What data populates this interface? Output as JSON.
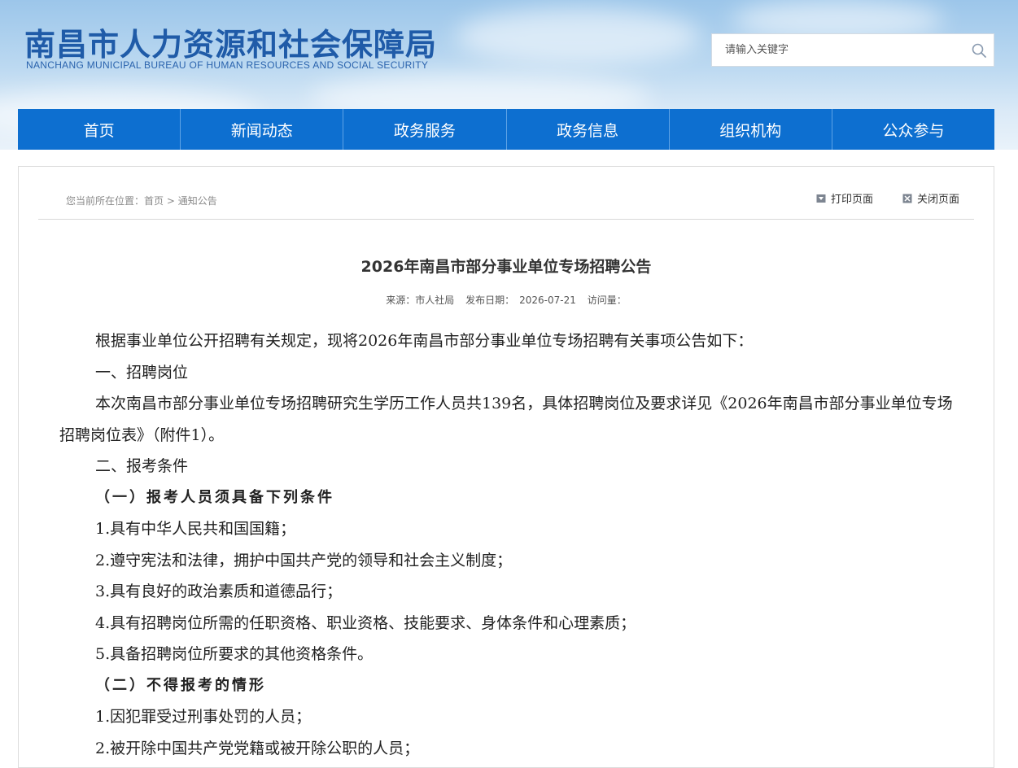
{
  "header": {
    "title": "南昌市人力资源和社会保障局",
    "subtitle": "NANCHANG MUNICIPAL BUREAU OF HUMAN RESOURCES AND SOCIAL SECURITY",
    "search_placeholder": "请输入关键字"
  },
  "nav": {
    "items": [
      "首页",
      "新闻动态",
      "政务服务",
      "政务信息",
      "组织机构",
      "公众参与"
    ]
  },
  "breadcrumb": {
    "prefix": "您当前所在位置：",
    "home": "首页",
    "sep": " > ",
    "current": "通知公告"
  },
  "tools": {
    "print": "打印页面",
    "close": "关闭页面"
  },
  "article": {
    "title": "2026年南昌市部分事业单位专场招聘公告",
    "source_label": "来源：",
    "source": "市人社局",
    "date_label": "发布日期：",
    "date": "2026-07-21",
    "views_label": "访问量：",
    "paragraphs": [
      "根据事业单位公开招聘有关规定，现将2026年南昌市部分事业单位专场招聘有关事项公告如下：",
      "一、招聘岗位",
      "本次南昌市部分事业单位专场招聘研究生学历工作人员共139名，具体招聘岗位及要求详见《2026年南昌市部分事业单位专场招聘岗位表》（附件1）。",
      "二、报考条件",
      "（一）报考人员须具备下列条件",
      "1.具有中华人民共和国国籍；",
      "2.遵守宪法和法律，拥护中国共产党的领导和社会主义制度；",
      "3.具有良好的政治素质和道德品行；",
      "4.具有招聘岗位所需的任职资格、职业资格、技能要求、身体条件和心理素质；",
      "5.具备招聘岗位所要求的其他资格条件。",
      "（二）不得报考的情形",
      "1.因犯罪受过刑事处罚的人员；",
      "2.被开除中国共产党党籍或被开除公职的人员；"
    ]
  },
  "colors": {
    "nav_bg": "#0d6fd0",
    "title_blue": "#1f5ba8"
  }
}
